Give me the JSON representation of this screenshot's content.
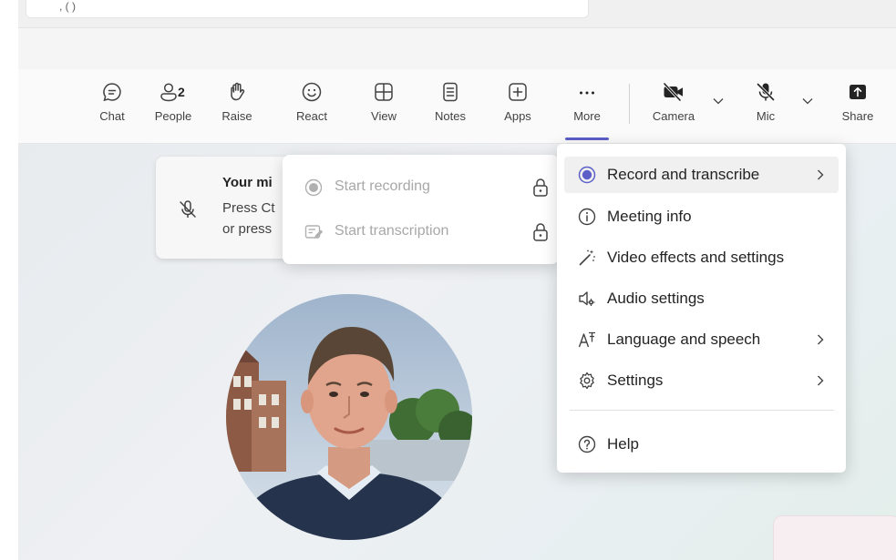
{
  "top_card": {
    "text": ", ( )"
  },
  "toolbar": {
    "chat_label": "Chat",
    "people_label": "People",
    "people_count": "2",
    "raise_label": "Raise",
    "react_label": "React",
    "view_label": "View",
    "notes_label": "Notes",
    "apps_label": "Apps",
    "more_label": "More",
    "camera_label": "Camera",
    "mic_label": "Mic",
    "share_label": "Share"
  },
  "notification": {
    "title": "Your mi",
    "line1": "Press Ct",
    "line2": "or press"
  },
  "submenu": {
    "items": [
      {
        "label": "Start recording",
        "icon": "record-dot-icon",
        "locked": true
      },
      {
        "label": "Start transcription",
        "icon": "transcript-icon",
        "locked": true
      }
    ]
  },
  "more_menu": {
    "items": [
      {
        "label": "Record and transcribe",
        "icon": "record-icon",
        "has_submenu": true
      },
      {
        "label": "Meeting info",
        "icon": "info-icon",
        "has_submenu": false
      },
      {
        "label": "Video effects and settings",
        "icon": "magic-wand-icon",
        "has_submenu": false
      },
      {
        "label": "Audio settings",
        "icon": "speaker-gear-icon",
        "has_submenu": false
      },
      {
        "label": "Language and speech",
        "icon": "language-icon",
        "has_submenu": true
      },
      {
        "label": "Settings",
        "icon": "gear-icon",
        "has_submenu": true
      },
      {
        "label": "Help",
        "icon": "help-icon",
        "has_submenu": false
      }
    ]
  },
  "colors": {
    "accent": "#5b5fc7",
    "text": "#242424",
    "disabled_text": "#a8a8a8"
  }
}
